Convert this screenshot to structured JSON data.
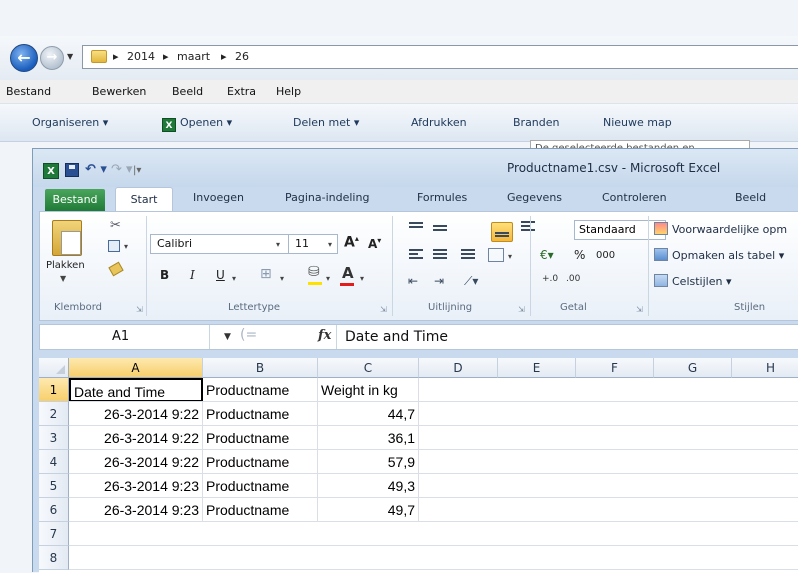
{
  "explorer": {
    "breadcrumb": [
      "2014",
      "maart",
      "26"
    ],
    "menu": [
      "Bestand",
      "Bewerken",
      "Beeld",
      "Extra",
      "Help"
    ],
    "commands": {
      "organize": "Organiseren",
      "open": "Openen",
      "share": "Delen met",
      "print": "Afdrukken",
      "burn": "Branden",
      "new_folder": "Nieuwe map"
    },
    "tooltip": "De geselecteerde bestanden en"
  },
  "excel": {
    "title": "Productname1.csv - Microsoft Excel",
    "tabs": {
      "file": "Bestand",
      "home": "Start",
      "insert": "Invoegen",
      "page_layout": "Pagina-indeling",
      "formulas": "Formules",
      "data": "Gegevens",
      "review": "Controleren",
      "view": "Beeld"
    },
    "ribbon": {
      "paste": "Plakken",
      "font_name": "Calibri",
      "font_size": "11",
      "bold": "B",
      "italic": "I",
      "underline": "U",
      "grow_font": "A",
      "shrink_font": "A",
      "number_format": "Standaard",
      "percent": "%",
      "thousands": "000",
      "conditional_formatting": "Voorwaardelijke opm",
      "format_as_table": "Opmaken als tabel",
      "cell_styles": "Celstijlen",
      "groups": {
        "clipboard": "Klembord",
        "font": "Lettertype",
        "alignment": "Uitlijning",
        "number": "Getal",
        "styles": "Stijlen"
      }
    },
    "formula_bar": {
      "name_box": "A1",
      "fx": "fx",
      "content": "Date and Time"
    },
    "sheet": {
      "columns": [
        "A",
        "B",
        "C",
        "D",
        "E",
        "F",
        "G",
        "H"
      ],
      "rows": [
        "1",
        "2",
        "3",
        "4",
        "5",
        "6",
        "7",
        "8"
      ],
      "data": [
        [
          "Date and Time",
          "Productname",
          "Weight in kg"
        ],
        [
          "26-3-2014 9:22",
          "Productname",
          "44,7"
        ],
        [
          "26-3-2014 9:22",
          "Productname",
          "36,1"
        ],
        [
          "26-3-2014 9:22",
          "Productname",
          "57,9"
        ],
        [
          "26-3-2014 9:23",
          "Productname",
          "49,3"
        ],
        [
          "26-3-2014 9:23",
          "Productname",
          "49,7"
        ]
      ]
    }
  }
}
